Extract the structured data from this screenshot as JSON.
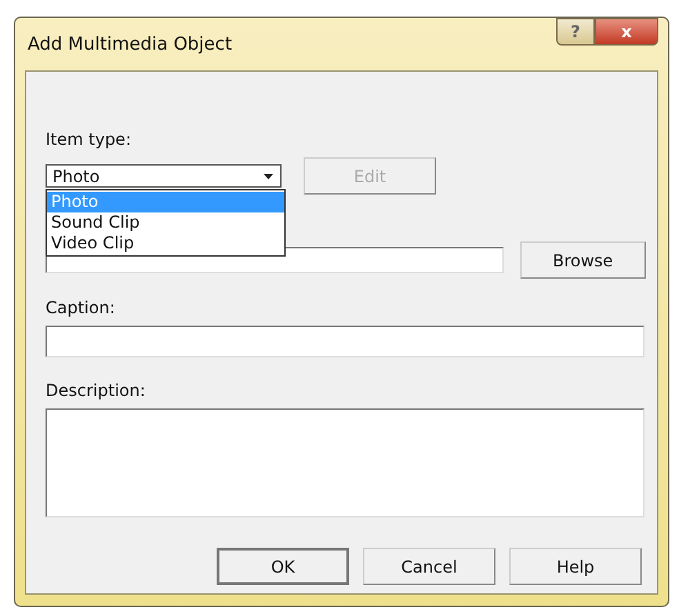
{
  "window": {
    "title": "Add Multimedia Object",
    "help_glyph": "?",
    "close_glyph": "x"
  },
  "item_type": {
    "label": "Item type:",
    "value": "Photo",
    "expanded": true,
    "options": [
      {
        "label": "Photo",
        "selected": true
      },
      {
        "label": "Sound Clip",
        "selected": false
      },
      {
        "label": "Video Clip",
        "selected": false
      }
    ]
  },
  "edit_button": {
    "label": "Edit",
    "disabled": true
  },
  "browse_button": {
    "label": "Browse"
  },
  "caption": {
    "label": "Caption:"
  },
  "description": {
    "label": "Description:"
  },
  "buttons": [
    {
      "label": "OK",
      "default": true
    },
    {
      "label": "Cancel",
      "default": false
    },
    {
      "label": "Help",
      "default": false
    }
  ]
}
